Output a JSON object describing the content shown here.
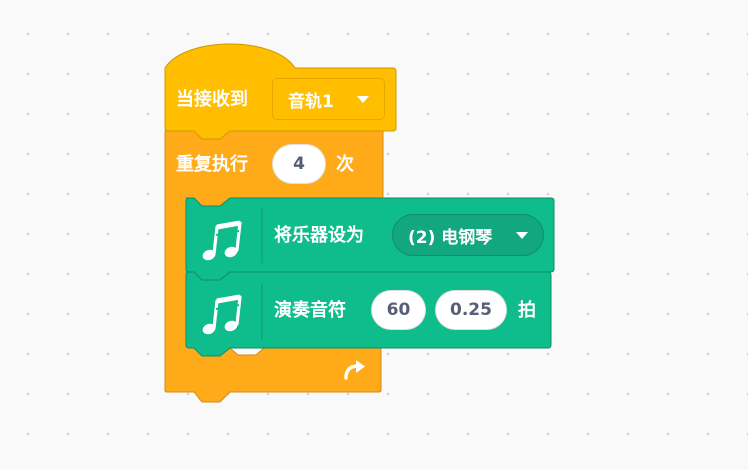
{
  "colors": {
    "event": "#ffbf00",
    "control": "#ffab19",
    "music": "#0fbd8c",
    "text": "#ffffff",
    "input_text": "#575e75"
  },
  "script": {
    "hat": {
      "label": "当接收到",
      "message_value": "音轨1",
      "icon": "none"
    },
    "repeat": {
      "label_before": "重复执行",
      "count": "4",
      "label_after": "次",
      "end_icon": "loop-arrow-icon"
    },
    "set_instrument": {
      "icon": "music-notes-icon",
      "label": "将乐器设为",
      "instrument_value": "(2) 电钢琴"
    },
    "play_note": {
      "icon": "music-notes-icon",
      "label": "演奏音符",
      "note": "60",
      "beats": "0.25",
      "label_after": "拍"
    }
  }
}
